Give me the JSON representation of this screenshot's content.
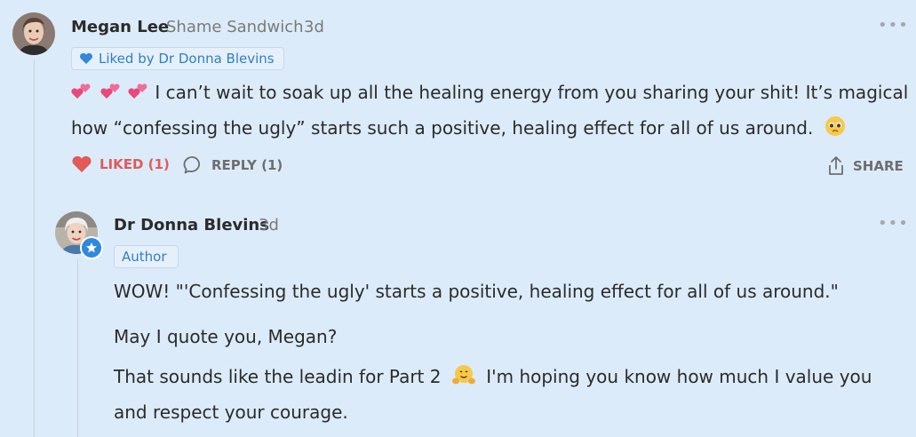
{
  "comments": [
    {
      "author": "Megan Lee",
      "publication": "Shame Sandwich",
      "time": "3d",
      "liked_by": "Liked by Dr Donna Blevins",
      "text_line1": "I can’t wait to soak up all the healing energy from you sharing your shit! It’s magical",
      "text_line2": "how “confessing the ugly” starts such a positive, healing effect for all of us around.",
      "actions": {
        "liked": "LIKED (1)",
        "reply": "REPLY (1)",
        "share": "SHARE"
      }
    },
    {
      "author": "Dr Donna Blevins",
      "time": "3d",
      "badge": "Author",
      "paragraph1": "WOW! \"'Confessing the ugly' starts a positive, healing effect for all of us around.\"",
      "paragraph2": "May I quote you, Megan?",
      "paragraph3_line1": "That sounds like the leadin for Part 2",
      "paragraph3_line1b": "I'm hoping you know how much I value you",
      "paragraph3_line2": "and respect your courage."
    }
  ],
  "menu_glyph": "•••",
  "colors": {
    "background": "#dcebf9",
    "accent_blue": "#2f7fc6",
    "liked_red": "#e05a5a"
  },
  "icons": [
    "heart-icon",
    "comment-icon",
    "share-icon",
    "more-icon",
    "star-icon",
    "two-hearts-emoji",
    "pleading-face-emoji",
    "hugging-face-emoji"
  ]
}
